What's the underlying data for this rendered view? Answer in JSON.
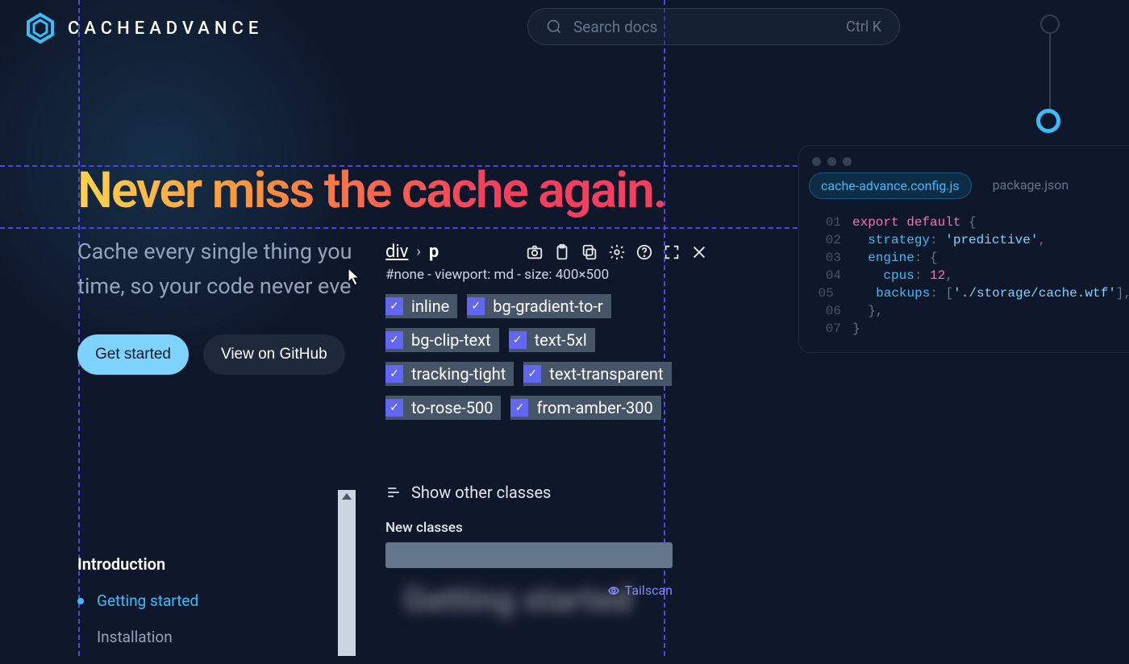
{
  "brand": {
    "name": "CACHEADVANCE"
  },
  "search": {
    "placeholder": "Search docs",
    "shortcut": "Ctrl K"
  },
  "hero": {
    "title": "Never miss the cache again.",
    "sub1": "Cache every single thing you",
    "sub2": "time, so your code never eve",
    "primary_btn": "Get started",
    "secondary_btn": "View on GitHub"
  },
  "code": {
    "tabs": [
      "cache-advance.config.js",
      "package.json"
    ],
    "lines": [
      {
        "n": "01",
        "html": "<span class='tk-kw'>export</span> <span class='tk-kw'>default</span> <span class='tk-punc'>{</span>"
      },
      {
        "n": "02",
        "html": "  <span class='tk-key'>strategy</span><span class='tk-punc'>:</span> <span class='tk-str'>'predictive'</span><span class='tk-punc'>,</span>"
      },
      {
        "n": "03",
        "html": "  <span class='tk-key'>engine</span><span class='tk-punc'>:</span> <span class='tk-punc'>{</span>"
      },
      {
        "n": "04",
        "html": "    <span class='tk-key'>cpus</span><span class='tk-punc'>:</span> <span class='tk-num'>12</span><span class='tk-punc'>,</span>"
      },
      {
        "n": "05",
        "html": "    <span class='tk-key'>backups</span><span class='tk-punc'>:</span> <span class='tk-punc'>[</span><span class='tk-str'>'./storage/cache.wtf'</span><span class='tk-punc'>],</span>"
      },
      {
        "n": "06",
        "html": "  <span class='tk-punc'>},</span>"
      },
      {
        "n": "07",
        "html": "<span class='tk-punc'>}</span>"
      }
    ]
  },
  "sidebar": {
    "heading": "Introduction",
    "items": [
      {
        "label": "Getting started",
        "active": true
      },
      {
        "label": "Installation",
        "active": false
      }
    ]
  },
  "inspector": {
    "breadcrumb": [
      "div",
      "p"
    ],
    "meta": "#none - viewport: md - size: 400×500",
    "classes": [
      "inline",
      "bg-gradient-to-r",
      "bg-clip-text",
      "text-5xl",
      "tracking-tight",
      "text-transparent",
      "to-rose-500",
      "from-amber-300"
    ],
    "show_other": "Show other classes",
    "new_classes_label": "New classes",
    "brand": "Tailscan"
  },
  "blurred_heading": "Getting started"
}
